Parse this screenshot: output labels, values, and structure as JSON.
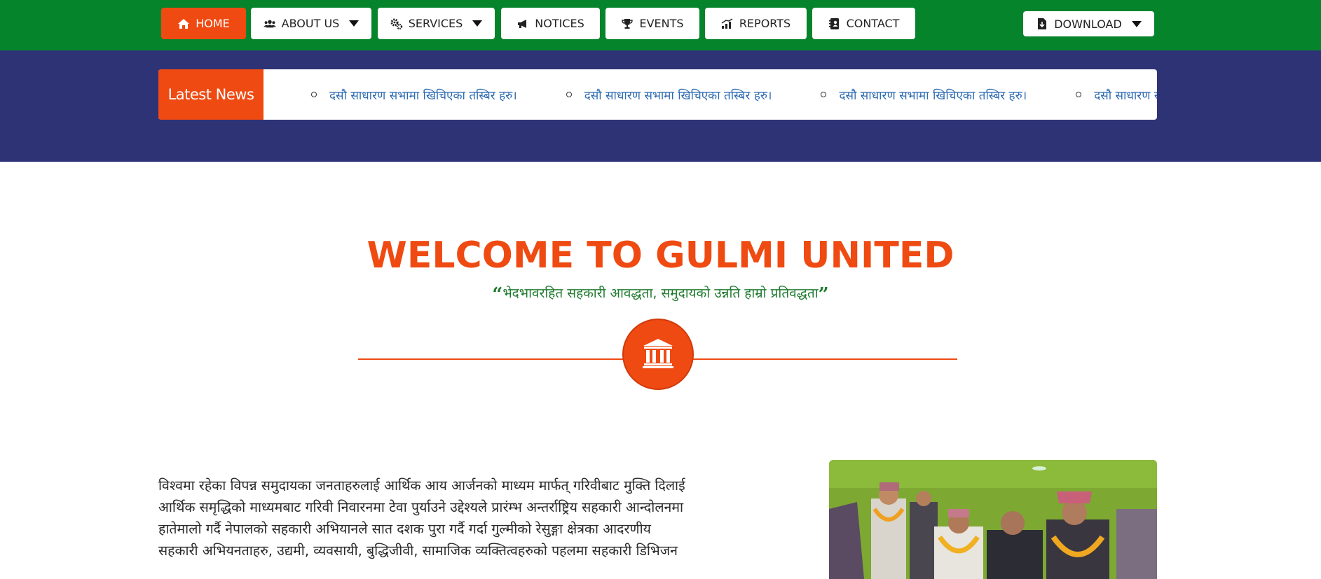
{
  "nav": {
    "home": "HOME",
    "about": "ABOUT US",
    "services": "SERVICES",
    "notices": "NOTICES",
    "events": "EVENTS",
    "reports": "REPORTS",
    "contact": "CONTACT",
    "download": "DOWNLOAD"
  },
  "colors": {
    "nav_green": "#05842b",
    "accent_orange": "#ef4a12",
    "news_band": "#2e3375",
    "news_link": "#2c6ab1",
    "tagline_green": "#1f7a2f"
  },
  "icons": {
    "home": "home-icon",
    "about": "users-icon",
    "services": "gears-icon",
    "notices": "megaphone-icon",
    "events": "trophy-icon",
    "reports": "chart-icon",
    "contact": "contact-book-icon",
    "download": "file-download-icon",
    "emblem": "bank-icon"
  },
  "news": {
    "label": "Latest News",
    "items": [
      "दसौ साधारण सभामा खिचिएका तस्बिर हरु।",
      "दसौ साधारण सभामा खिचिएका तस्बिर हरु।",
      "दसौ साधारण सभामा खिचिएका तस्बिर हरु।",
      "दसौ साधारण सभामा खिचिएका तस्बिर हरु।"
    ]
  },
  "welcome": {
    "title": "WELCOME TO GULMI UNITED",
    "open_quote": "“",
    "tagline": "भेदभावरहित सहकारी आवद्धता, समुदायको उन्नति हाम्रो प्रतिवद्धता",
    "close_quote": "”"
  },
  "intro": {
    "lines": [
      "विश्वमा रहेका विपन्न समुदायका जनताहरुलाई आर्थिक आय आर्जनको माध्यम मार्फत् गरिवीबाट मुक्ति दिलाई",
      "आर्थिक समृद्धिको माध्यमबाट गरिवी निवारनमा टेवा पुर्याउने उद्देश्यले प्रारंम्भ अन्तर्राष्ट्रिय सहकारी आन्दोलनमा",
      "हातेमालो गर्दै नेपालको सहकारी अभियानले सात दशक पुरा गर्दै गर्दा गुल्मीको रेसुङ्गा क्षेत्रका आदरणीय",
      "सहकारी अभियनताहरु, उद्यमी, व्यवसायी, बुद्धिजीवी, सामाजिक व्यक्तित्वहरुको पहलमा सहकारी डिभिजन"
    ]
  }
}
